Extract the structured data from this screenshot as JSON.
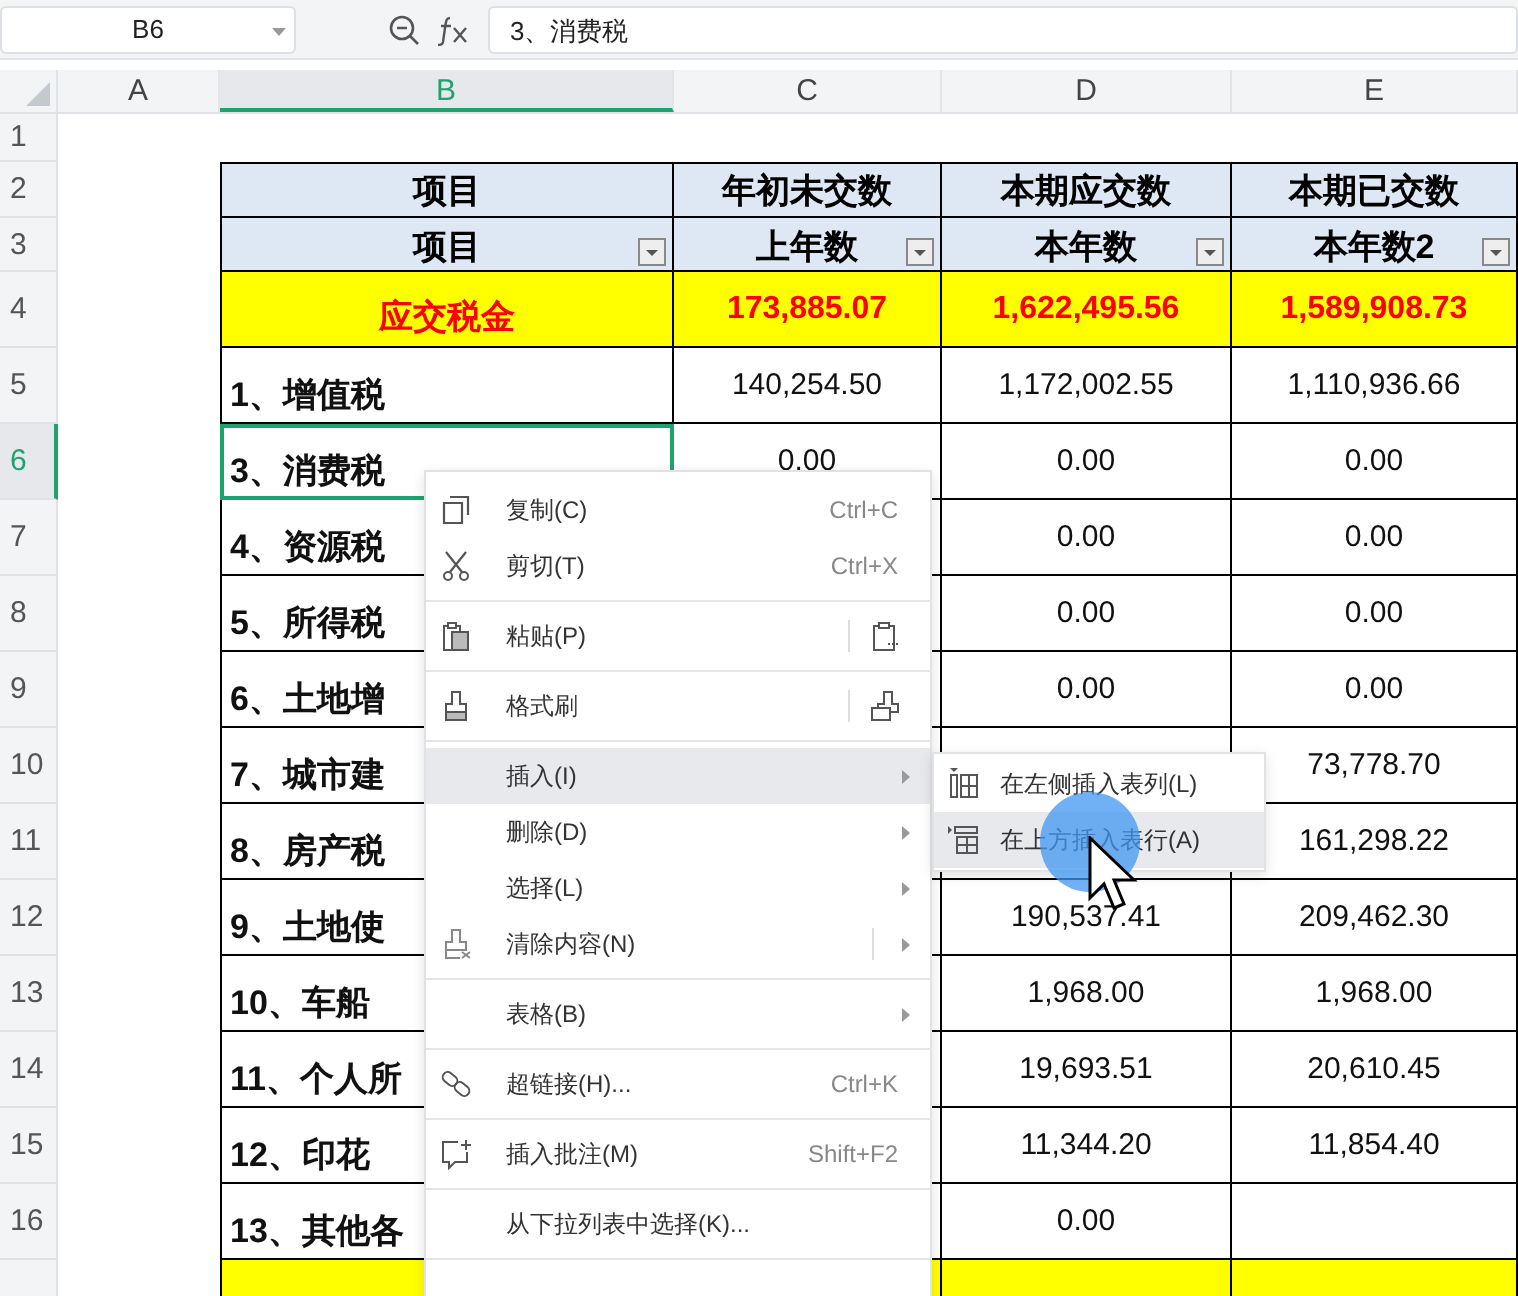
{
  "name_box": "B6",
  "formula": "3、消费税",
  "columns": [
    {
      "label": "A",
      "selected": false
    },
    {
      "label": "B",
      "selected": true
    },
    {
      "label": "C",
      "selected": false
    },
    {
      "label": "D",
      "selected": false
    },
    {
      "label": "E",
      "selected": false
    }
  ],
  "rows": [
    {
      "number": "1",
      "kind": "blank",
      "selected": false
    },
    {
      "number": "2",
      "kind": "title",
      "selected": false,
      "b": "项目",
      "c": "年初未交数",
      "d": "本期应交数",
      "e": "本期已交数"
    },
    {
      "number": "3",
      "kind": "subtitle",
      "selected": false,
      "filter": true,
      "b": "项目",
      "c": "上年数",
      "d": "本年数",
      "e": "本年数2"
    },
    {
      "number": "4",
      "kind": "total",
      "selected": false,
      "b": "应交税金",
      "c": "173,885.07",
      "d": "1,622,495.56",
      "e": "1,589,908.73"
    },
    {
      "number": "5",
      "kind": "item",
      "selected": false,
      "b": "1、增值税",
      "c": "140,254.50",
      "d": "1,172,002.55",
      "e": "1,110,936.66"
    },
    {
      "number": "6",
      "kind": "item",
      "selected": true,
      "b": "3、消费税",
      "c": "0.00",
      "d": "0.00",
      "e": "0.00"
    },
    {
      "number": "7",
      "kind": "item",
      "selected": false,
      "b": "4、资源税",
      "d": "0.00",
      "e": "0.00"
    },
    {
      "number": "8",
      "kind": "item",
      "selected": false,
      "b": "5、所得税",
      "d": "0.00",
      "e": "0.00"
    },
    {
      "number": "9",
      "kind": "item",
      "selected": false,
      "b": "6、土地增",
      "d": "0.00",
      "e": "0.00"
    },
    {
      "number": "10",
      "kind": "item",
      "selected": false,
      "b": "7、城市建",
      "e": "73,778.70"
    },
    {
      "number": "11",
      "kind": "item",
      "selected": false,
      "b": "8、房产税",
      "e": "161,298.22"
    },
    {
      "number": "12",
      "kind": "item",
      "selected": false,
      "b": "9、土地使",
      "d": "190,537.41",
      "e": "209,462.30"
    },
    {
      "number": "13",
      "kind": "item",
      "selected": false,
      "b": "10、车船",
      "d": "1,968.00",
      "e": "1,968.00"
    },
    {
      "number": "14",
      "kind": "item",
      "selected": false,
      "b": "11、个人所",
      "d": "19,693.51",
      "e": "20,610.45"
    },
    {
      "number": "15",
      "kind": "item",
      "selected": false,
      "b": "12、印花",
      "d": "11,344.20",
      "e": "11,854.40"
    },
    {
      "number": "16",
      "kind": "item",
      "selected": false,
      "b": "13、其他各",
      "d": "0.00"
    },
    {
      "kind": "strip",
      "selected": false
    }
  ],
  "context_menu": [
    [
      {
        "label": "复制(C)",
        "shortcut": "Ctrl+C",
        "submenu": false,
        "selected": false
      },
      {
        "label": "剪切(T)",
        "shortcut": "Ctrl+X",
        "submenu": false,
        "selected": false
      }
    ],
    [
      {
        "label": "粘贴(P)",
        "submenu": false,
        "selected": false
      }
    ],
    [
      {
        "label": "格式刷",
        "submenu": false,
        "selected": false
      }
    ],
    [
      {
        "label": "插入(I)",
        "submenu": true,
        "selected": true
      },
      {
        "label": "删除(D)",
        "submenu": true,
        "selected": false
      },
      {
        "label": "选择(L)",
        "submenu": true,
        "selected": false
      },
      {
        "label": "清除内容(N)",
        "submenu": true,
        "selected": false
      }
    ],
    [
      {
        "label": "表格(B)",
        "submenu": true,
        "selected": false
      }
    ],
    [
      {
        "label": "超链接(H)...",
        "shortcut": "Ctrl+K",
        "submenu": false,
        "selected": false
      }
    ],
    [
      {
        "label": "插入批注(M)",
        "shortcut": "Shift+F2",
        "submenu": false,
        "selected": false
      }
    ],
    [
      {
        "label": "从下拉列表中选择(K)...",
        "submenu": false,
        "selected": false
      }
    ]
  ],
  "submenu": [
    {
      "label": "在左侧插入表列(L)",
      "selected": false
    },
    {
      "label": "在上方插入表行(A)",
      "selected": true
    }
  ]
}
